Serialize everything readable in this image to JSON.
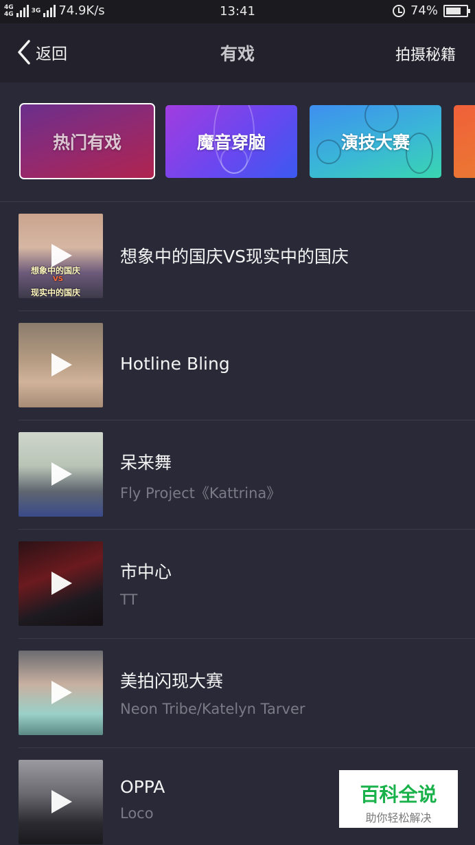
{
  "status_bar": {
    "network_1": "4G",
    "network_2": "4G",
    "network_3": "3G",
    "speed": "74.9K/s",
    "time": "13:41",
    "battery": "74%",
    "battery_level": 0.74
  },
  "header": {
    "back_label": "返回",
    "title": "有戏",
    "tips_label": "拍摄秘籍"
  },
  "categories": [
    {
      "label": "热门有戏",
      "selected": true
    },
    {
      "label": "魔音穿脑",
      "selected": false
    },
    {
      "label": "演技大赛",
      "selected": false
    },
    {
      "label": "",
      "selected": false
    }
  ],
  "items": [
    {
      "title": "想象中的国庆VS现实中的国庆",
      "artist": "",
      "thumb_caption_1": "想象中的国庆",
      "thumb_caption_2": "VS",
      "thumb_caption_3": "现实中的国庆"
    },
    {
      "title": "Hotline Bling",
      "artist": ""
    },
    {
      "title": "呆来舞",
      "artist": "Fly Project《Kattrina》"
    },
    {
      "title": "市中心",
      "artist": "TT"
    },
    {
      "title": "美拍闪现大赛",
      "artist": "Neon Tribe/Katelyn Tarver"
    },
    {
      "title": "OPPA",
      "artist": "Loco"
    }
  ],
  "watermark": {
    "title": "百科全说",
    "subtitle": "助你轻松解决"
  }
}
